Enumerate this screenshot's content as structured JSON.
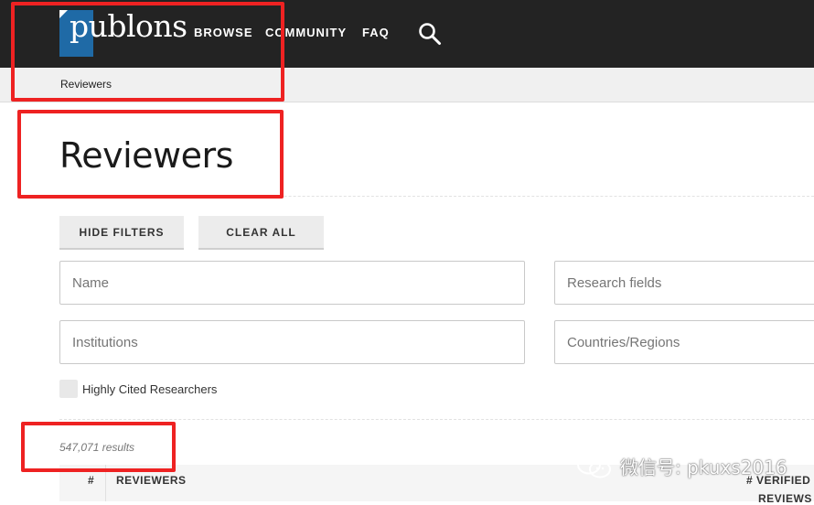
{
  "brand": {
    "name": "publons"
  },
  "nav": {
    "items": [
      {
        "label": "BROWSE"
      },
      {
        "label": "COMMUNITY"
      },
      {
        "label": "FAQ"
      }
    ],
    "search_icon": "search-icon"
  },
  "breadcrumb": {
    "current": "Reviewers"
  },
  "page": {
    "title": "Reviewers"
  },
  "filters": {
    "hide_label": "HIDE FILTERS",
    "clear_label": "CLEAR ALL",
    "name_placeholder": "Name",
    "research_fields_placeholder": "Research fields",
    "institutions_placeholder": "Institutions",
    "countries_placeholder": "Countries/Regions",
    "highly_cited_label": "Highly Cited Researchers",
    "highly_cited_checked": false
  },
  "results": {
    "count_text": "547,071 results"
  },
  "table": {
    "headers": {
      "rank": "#",
      "reviewers": "REVIEWERS",
      "verified_line1": "# VERIFIED",
      "verified_line2": "REVIEWS"
    }
  },
  "watermark": {
    "text": "微信号: pkuxs2016"
  },
  "colors": {
    "topbar": "#232323",
    "logo_blue": "#1f6aa6",
    "annotation_red": "#ee2222"
  }
}
